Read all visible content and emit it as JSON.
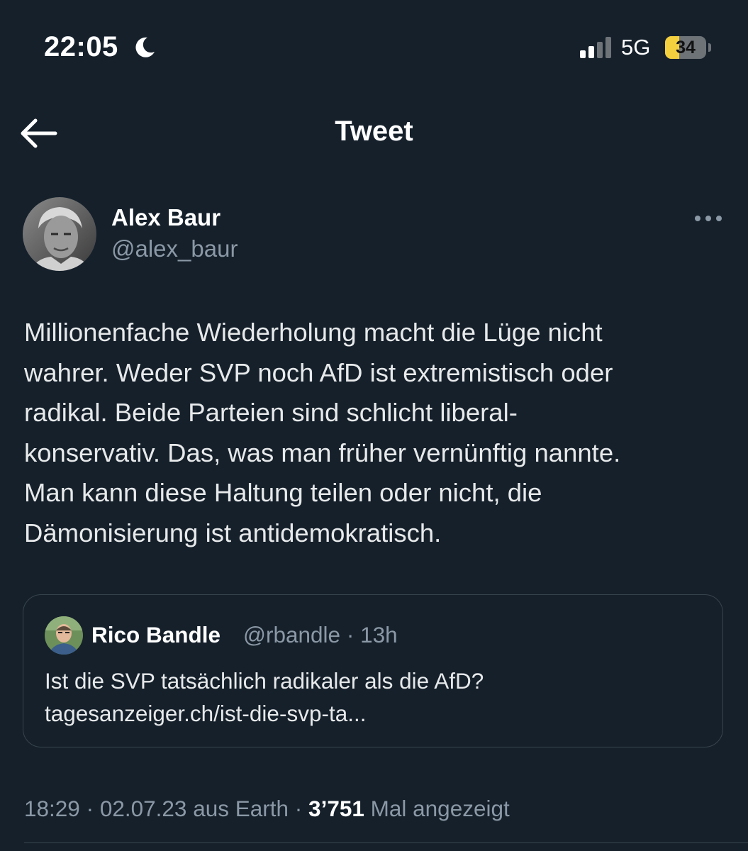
{
  "status_bar": {
    "time": "22:05",
    "network": "5G",
    "battery_level": "34",
    "battery_fraction": 0.34,
    "icons": [
      "moon-icon",
      "signal-icon",
      "battery-icon"
    ]
  },
  "header": {
    "back_icon": "arrow-left-icon",
    "title": "Tweet"
  },
  "tweet": {
    "author": {
      "name": "Alex Baur",
      "handle": "@alex_baur"
    },
    "more_icon": "more-horizontal-icon",
    "text": "Millionenfache Wiederholung macht die Lüge nicht\nwahrer. Weder SVP noch AfD ist extremistisch oder\nradikal. Beide Parteien sind schlicht liberal-\nkonservativ. Das, was man früher vernünftig nannte.\nMan kann diese Haltung teilen oder nicht, die\nDämonisierung ist antidemokratisch.",
    "quote": {
      "name": "Rico Bandle",
      "handle": "@rbandle",
      "separator": "·",
      "time": "13h",
      "text": "Ist die SVP tatsächlich radikaler als die AfD?\ntagesanzeiger.ch/ist-die-svp-ta..."
    },
    "meta": {
      "time": "18:29",
      "separator1": " · ",
      "date": "02.07.23",
      "source": " aus Earth",
      "separator2": " · ",
      "views": "3’751",
      "views_label": " Mal angezeigt"
    }
  },
  "colors": {
    "background": "#15202b",
    "text": "#e7e9ea",
    "secondary": "#8b98a5",
    "border": "#38444d",
    "battery": "#f4d03f"
  }
}
